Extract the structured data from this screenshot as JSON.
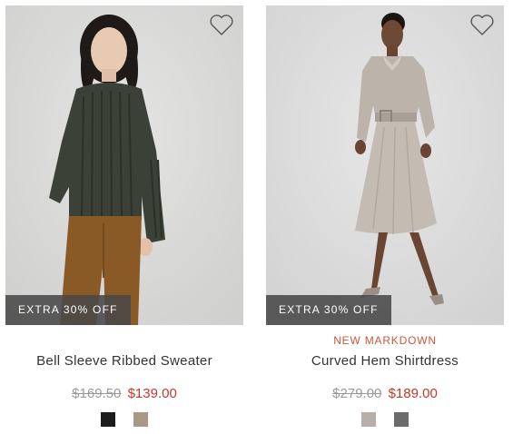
{
  "products": [
    {
      "promo_label": "EXTRA 30% OFF",
      "markdown_label": "",
      "name": "Bell Sleeve Ribbed Sweater",
      "original_price": "$169.50",
      "sale_price": "$139.00",
      "wishlist_icon": "heart-outline-icon",
      "swatches": [
        "#1c1c1c",
        "#a89888"
      ]
    },
    {
      "promo_label": "EXTRA 30% OFF",
      "markdown_label": "NEW MARKDOWN",
      "name": "Curved Hem Shirtdress",
      "original_price": "$279.00",
      "sale_price": "$189.00",
      "wishlist_icon": "heart-outline-icon",
      "swatches": [
        "#b8b0a8",
        "#6b6b6b"
      ]
    }
  ],
  "colors": {
    "sale_price": "#c0392b",
    "markdown": "#d0563a",
    "promo_bg": "#484848"
  }
}
